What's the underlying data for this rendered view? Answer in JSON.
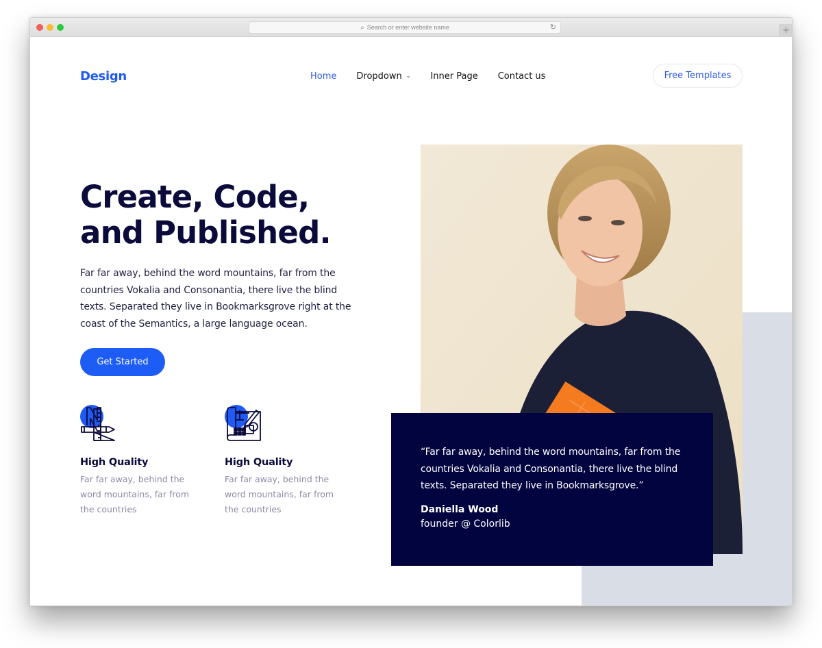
{
  "browser": {
    "url_placeholder": "Search or enter website name",
    "icons": {
      "search": "magnifier-icon",
      "reload": "reload-icon",
      "new_tab": "plus-icon"
    },
    "traffic_light_colors": {
      "close": "#ee5f57",
      "minimize": "#f5bd2f",
      "maximize": "#2bc840"
    }
  },
  "header": {
    "logo": "Design",
    "nav": [
      {
        "label": "Home",
        "active": true
      },
      {
        "label": "Dropdown",
        "has_dropdown": true
      },
      {
        "label": "Inner Page"
      },
      {
        "label": "Contact us"
      }
    ],
    "dropdown_chevron": "⌄",
    "cta_label": "Free Templates"
  },
  "hero": {
    "title_line1": "Create, Code,",
    "title_line2": "and Published.",
    "description": "Far far away, behind the word mountains, far from the countries Vokalia and Consonantia, there live the blind texts. Separated they live in Bookmarksgrove right at the coast of the Semantics, a large language ocean.",
    "button_label": "Get Started"
  },
  "features": [
    {
      "icon": "design-tools-icon",
      "title": "High Quality",
      "text": "Far far away, behind the word mountains, far from the countries"
    },
    {
      "icon": "blueprint-icon",
      "title": "High Quality",
      "text": "Far far away, behind the word mountains, far from the countries"
    }
  ],
  "testimonial": {
    "quote": "“Far far away, behind the word mountains, far from the countries Vokalia and Consonantia, there live the blind texts. Separated they live in Bookmarksgrove.”",
    "name": "Daniella Wood",
    "role": "founder @ Colorlib"
  },
  "colors": {
    "brand_blue": "#1d5cf5",
    "heading_navy": "#0b0b3b",
    "quote_bg": "#020440",
    "accent_gray": "#d9dee6",
    "muted_text": "#8a8aa6"
  }
}
